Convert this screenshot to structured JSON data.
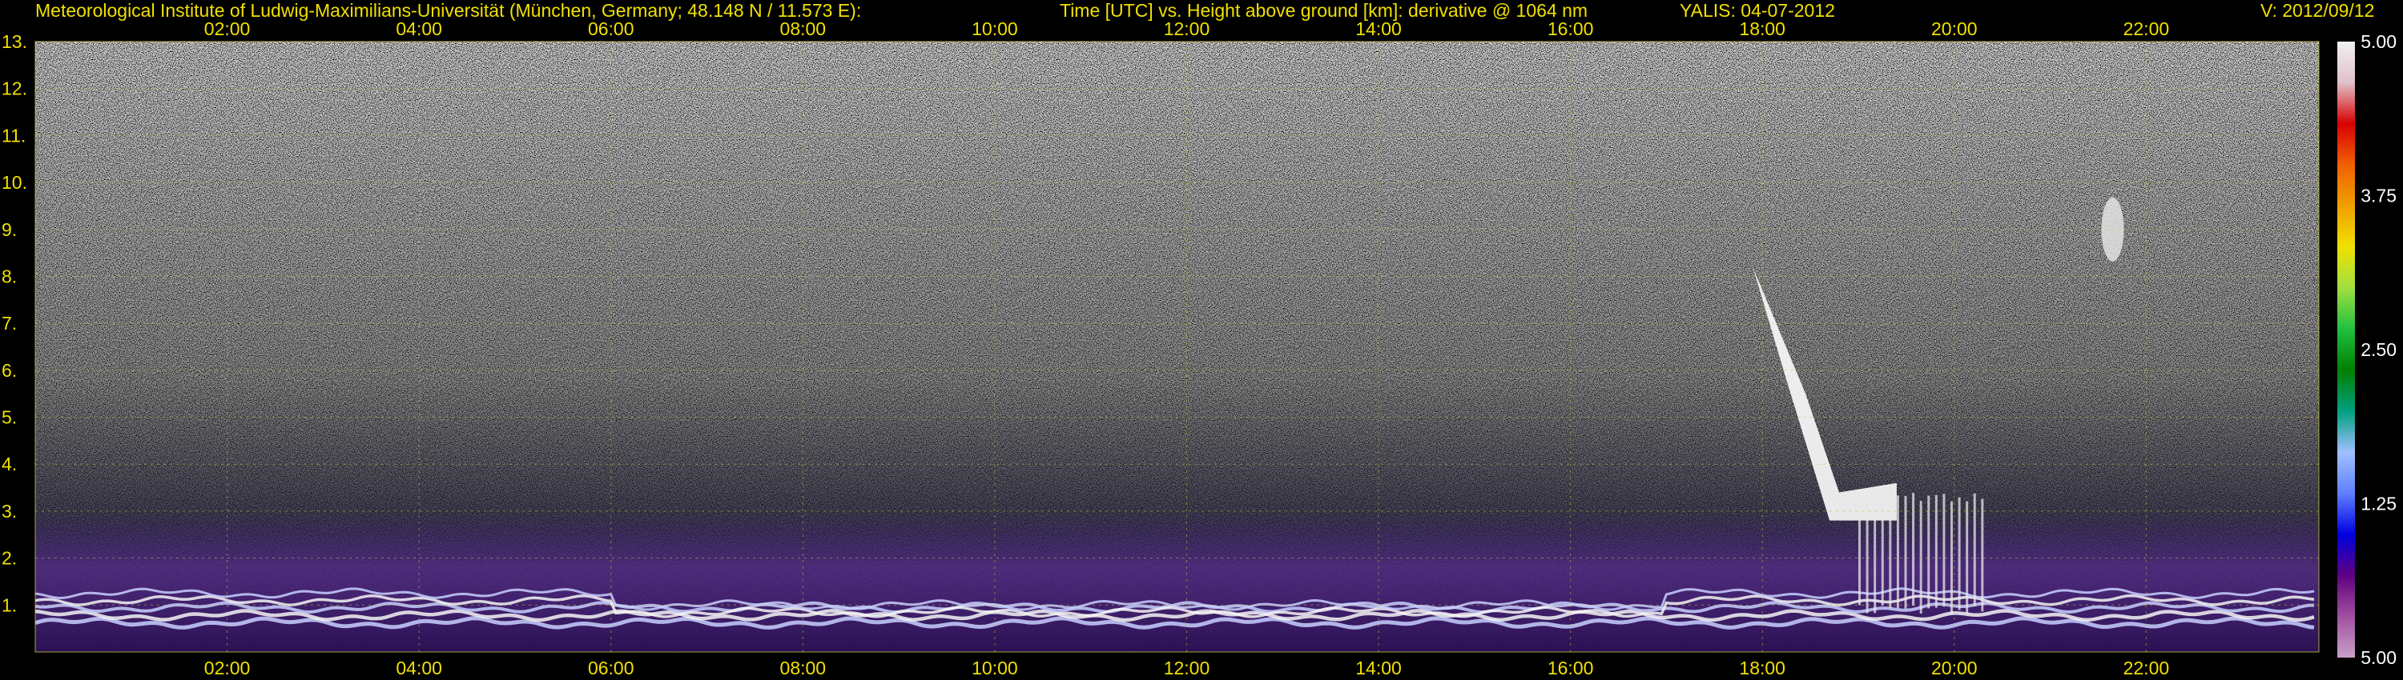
{
  "header": {
    "institute": "Meteorological Institute of Ludwig-Maximilians-Universität (München, Germany; 48.148 N / 11.573 E):",
    "title": "Time [UTC] vs. Height above ground [km]: derivative @ 1064 nm",
    "instrument": "YALIS: 04-07-2012",
    "version": "V: 2012/09/12"
  },
  "colors": {
    "text": "#f0e000",
    "grid": "#c8c040",
    "background": "#000000"
  },
  "chart_data": {
    "type": "heatmap",
    "title": "Time [UTC] vs. Height above ground [km]: derivative @ 1064 nm",
    "xlabel": "Time [UTC]",
    "ylabel": "Height above ground [km]",
    "x_ticks": [
      "02:00",
      "04:00",
      "06:00",
      "08:00",
      "10:00",
      "12:00",
      "14:00",
      "16:00",
      "18:00",
      "20:00",
      "22:00"
    ],
    "x_tick_hours": [
      2,
      4,
      6,
      8,
      10,
      12,
      14,
      16,
      18,
      20,
      22
    ],
    "xlim_hours": [
      0.0,
      23.8
    ],
    "y_ticks": [
      "1.",
      "2.",
      "3.",
      "4.",
      "5.",
      "6.",
      "7.",
      "8.",
      "9.",
      "10.",
      "11.",
      "12.",
      "13."
    ],
    "y_tick_values": [
      1,
      2,
      3,
      4,
      5,
      6,
      7,
      8,
      9,
      10,
      11,
      12,
      13
    ],
    "ylim": [
      0,
      13
    ],
    "grid": true,
    "colorbar": {
      "labels": [
        "5.00",
        "3.75",
        "2.50",
        "1.25",
        "5.00"
      ],
      "colors": [
        "#f0f0f0",
        "#e0c0c8",
        "#d80000",
        "#f06000",
        "#f0a000",
        "#f0e000",
        "#a0e040",
        "#20c040",
        "#008000",
        "#00a080",
        "#a0c0ff",
        "#6080ff",
        "#0000e0",
        "#600080",
        "#a050a0",
        "#c8a0c8"
      ]
    },
    "features": [
      {
        "name": "boundary layer",
        "x_hours": [
          0.0,
          23.8
        ],
        "height_km": [
          0.6,
          1.5
        ]
      },
      {
        "name": "descending cloud",
        "x_hours": [
          17.9,
          19.4
        ],
        "height_km": [
          2.8,
          8.2
        ]
      },
      {
        "name": "cloud layer",
        "x_hours": [
          19.0,
          20.3
        ],
        "height_km": [
          1.0,
          3.4
        ]
      },
      {
        "name": "upper cloud",
        "x_hours": [
          21.3,
          22.0
        ],
        "height_km": [
          8.0,
          10.0
        ]
      }
    ]
  }
}
